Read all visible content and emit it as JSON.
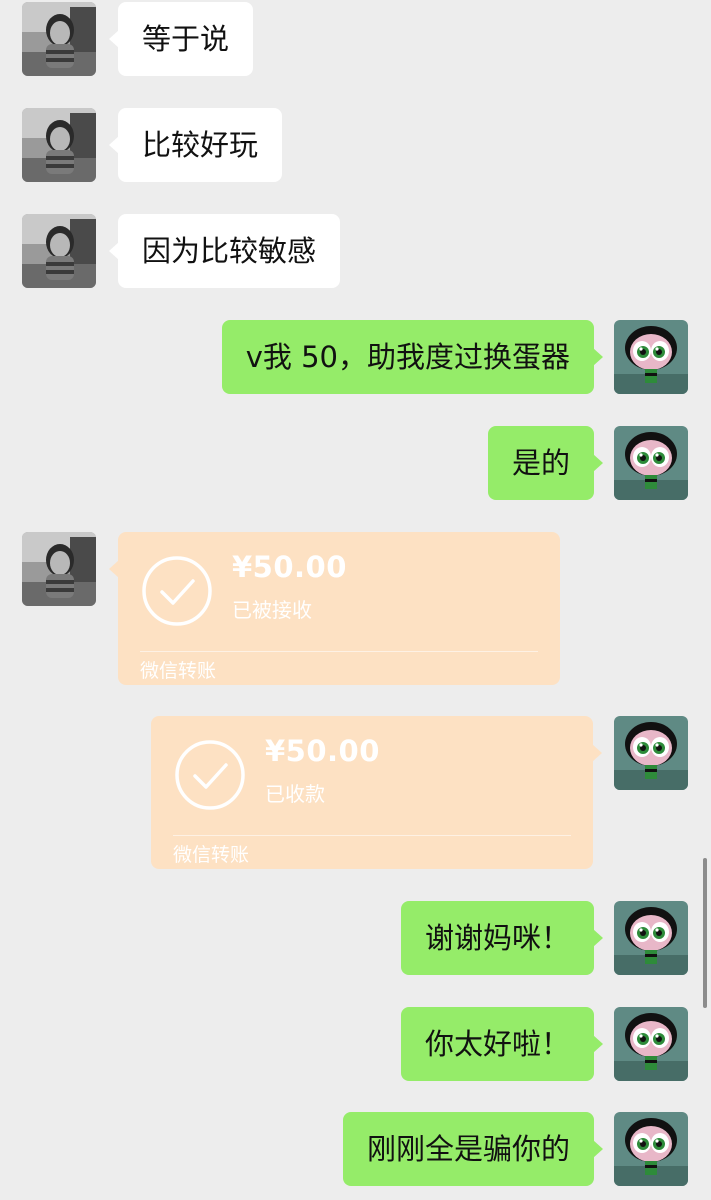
{
  "theme": {
    "background": "#ededed",
    "received_bubble": "#ffffff",
    "sent_bubble": "#95ec69",
    "transfer_card": "#fde1c3"
  },
  "contact_avatar": {
    "icon": "child-photo-avatar"
  },
  "my_avatar": {
    "icon": "powerpuff-buttercup-avatar"
  },
  "messages": [
    {
      "sender": "contact",
      "type": "text",
      "text": "等于说"
    },
    {
      "sender": "contact",
      "type": "text",
      "text": "比较好玩"
    },
    {
      "sender": "contact",
      "type": "text",
      "text": "因为比较敏感"
    },
    {
      "sender": "me",
      "type": "text",
      "text": "v我 50，助我度过换蛋器"
    },
    {
      "sender": "me",
      "type": "text",
      "text": "是的"
    },
    {
      "sender": "contact",
      "type": "transfer",
      "amount": "¥50.00",
      "status": "已被接收",
      "footer": "微信转账"
    },
    {
      "sender": "me",
      "type": "transfer",
      "amount": "¥50.00",
      "status": "已收款",
      "footer": "微信转账"
    },
    {
      "sender": "me",
      "type": "text",
      "text": "谢谢妈咪！"
    },
    {
      "sender": "me",
      "type": "text",
      "text": "你太好啦！"
    },
    {
      "sender": "me",
      "type": "text",
      "text": "刚刚全是骗你的"
    }
  ]
}
